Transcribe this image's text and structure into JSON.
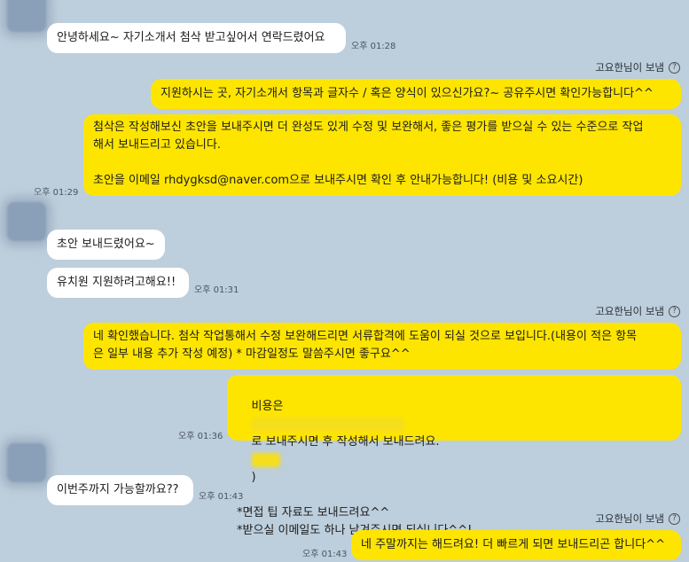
{
  "messages": {
    "m1": {
      "text": "안녕하세요~ 자기소개서 첨삭 받고싶어서 연락드렸어요",
      "time": "오후 01:28"
    },
    "sender1": {
      "text": "고요한님이 보냄"
    },
    "m2": {
      "text": "지원하시는 곳, 자기소개서 항목과 글자수 / 혹은 양식이 있으신가요?~ 공유주시면 확인가능합니다^^"
    },
    "m3": {
      "line1": "첨삭은 작성해보신 초안을 보내주시면 더 완성도 있게 수정 및 보완해서, 좋은 평가를 받으실 수 있는 수준으로 작업",
      "line2": "해서 보내드리고 있습니다.",
      "line3": "초안을 이메일 rhdygksd@naver.com으로 보내주시면 확인 후 안내가능합니다! (비용 및 소요시간)",
      "time": "오후 01:29"
    },
    "m4": {
      "text": "초안 보내드렸어요~"
    },
    "m5": {
      "text": "유치원 지원하려고해요!!",
      "time": "오후 01:31"
    },
    "sender2": {
      "text": "고요한님이 보냄"
    },
    "m6": {
      "line1": "네 확인했습니다. 첨삭 작업통해서 수정 보완해드리면 서류합격에 도움이 되실 것으로 보입니다.(내용이 적은 항목",
      "line2": "은 일부 내용 추가 작성 예정) * 마감일정도 말씀주시면 좋구요^^"
    },
    "m7": {
      "prefix": "비용은",
      "mid": "로 보내주시면 후 작성해서 보내드려요.",
      "suffix": ")",
      "line2": "*면접 팁 자료도 보내드려요^^",
      "line3": "*받으실 이메일도 하나 남겨주시면 되십니다^^!",
      "time": "오후 01:36"
    },
    "m8": {
      "text": "이번주까지 가능할까요??",
      "time": "오후 01:43"
    },
    "sender3": {
      "text": "고요한님이 보냄"
    },
    "m9": {
      "text": "네 주말까지는 해드려요! 더 빠르게 되면 보내드리곤 합니다^^",
      "time": "오후 01:43"
    },
    "icons": {
      "question": "?"
    }
  }
}
